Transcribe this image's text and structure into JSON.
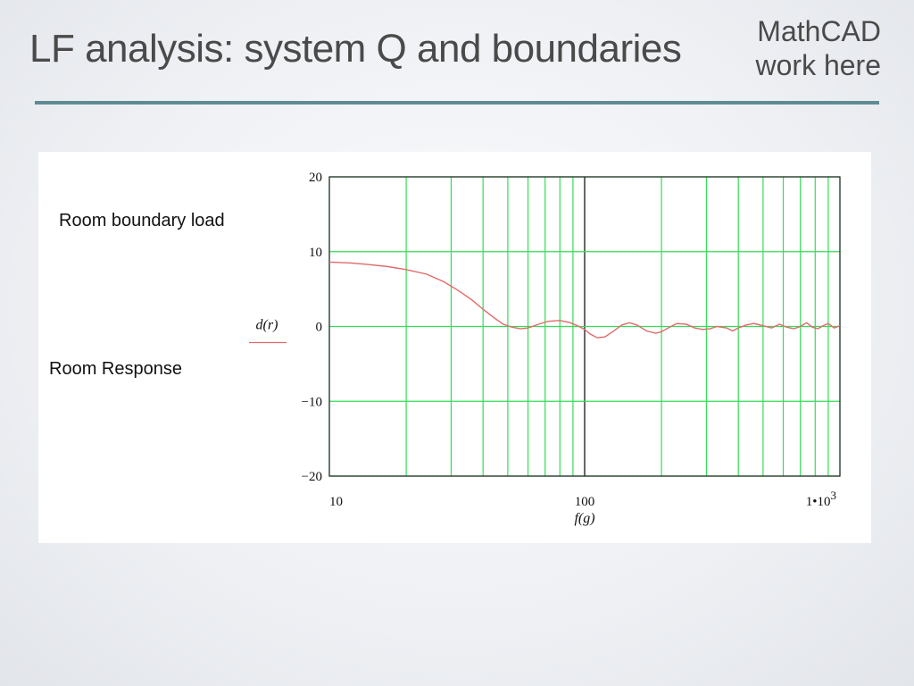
{
  "slide": {
    "title": "LF analysis: system Q and boundaries",
    "note_line1": "MathCAD",
    "note_line2": "work here",
    "rule_color": "#5f8b94"
  },
  "labels": {
    "boundary_load": "Room boundary load",
    "room_response": "Room Response"
  },
  "chart_data": {
    "type": "line",
    "xscale": "log",
    "xlim": [
      10,
      1000
    ],
    "ylim": [
      -20,
      20
    ],
    "xlabel": "f(g)",
    "ylabel": "d(r)",
    "grid": true,
    "grid_color": "#33dd55",
    "line_color": "#e06a6a",
    "x_ticks": [
      {
        "value": 10,
        "label": "10"
      },
      {
        "value": 100,
        "label": "100"
      },
      {
        "value": 1000,
        "label": "1•10",
        "sup": "3"
      }
    ],
    "y_ticks": [
      {
        "value": 20,
        "label": "20"
      },
      {
        "value": 10,
        "label": "10"
      },
      {
        "value": 0,
        "label": "0"
      },
      {
        "value": -10,
        "label": "−10"
      },
      {
        "value": -20,
        "label": "−20"
      }
    ],
    "series": [
      {
        "x": [
          10,
          12,
          14,
          17,
          20,
          24,
          28,
          32,
          36,
          40,
          44,
          48,
          52,
          56,
          60,
          66,
          72,
          80,
          88,
          95,
          100,
          105,
          112,
          120,
          130,
          140,
          150,
          160,
          175,
          190,
          200,
          215,
          230,
          250,
          270,
          290,
          310,
          330,
          360,
          380,
          400,
          430,
          460,
          500,
          540,
          580,
          620,
          660,
          700,
          740,
          780,
          820,
          860,
          900,
          950,
          1000
        ],
        "y": [
          8.6,
          8.5,
          8.3,
          8.0,
          7.6,
          7.0,
          6.0,
          4.8,
          3.6,
          2.3,
          1.2,
          0.3,
          -0.1,
          -0.3,
          -0.2,
          0.3,
          0.7,
          0.8,
          0.5,
          0.0,
          -0.4,
          -1.0,
          -1.5,
          -1.4,
          -0.6,
          0.2,
          0.5,
          0.2,
          -0.6,
          -0.9,
          -0.7,
          -0.1,
          0.4,
          0.3,
          -0.2,
          -0.4,
          -0.3,
          0.0,
          -0.2,
          -0.6,
          -0.2,
          0.2,
          0.4,
          0.1,
          -0.2,
          0.3,
          -0.1,
          -0.3,
          0.0,
          0.5,
          -0.1,
          -0.3,
          0.1,
          0.4,
          -0.2,
          0.1
        ]
      }
    ]
  }
}
